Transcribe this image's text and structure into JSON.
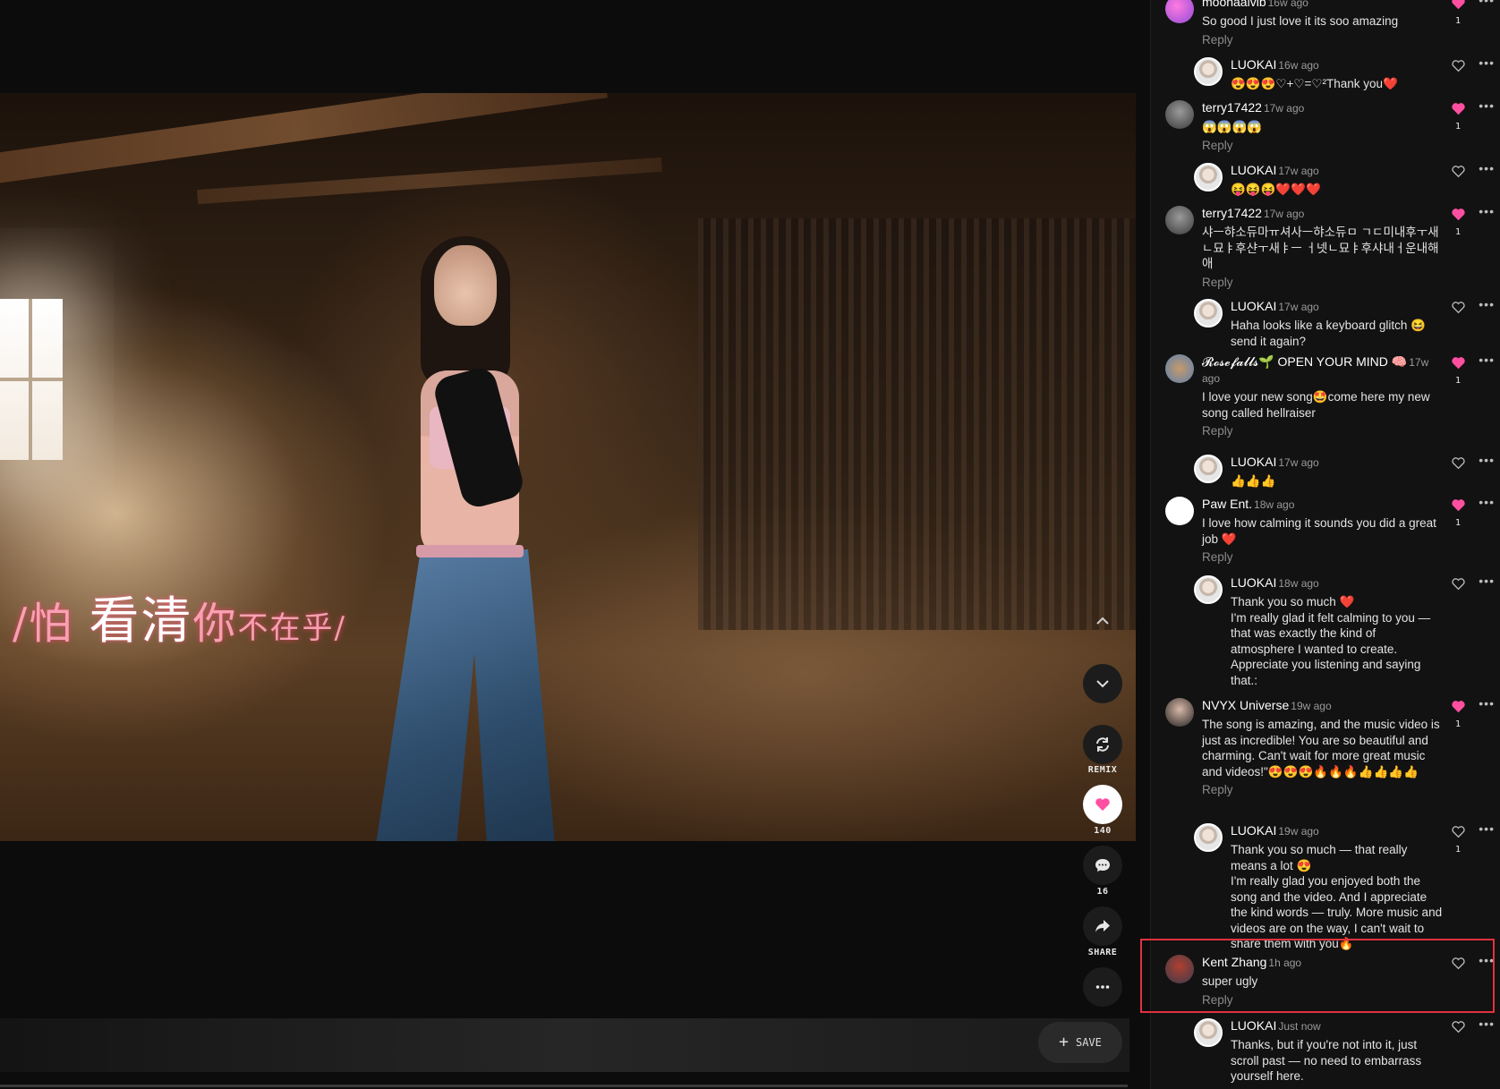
{
  "video": {
    "lyric_prefix": "/怕",
    "lyric_main": "看清",
    "lyric_mid": "你",
    "lyric_tail": "不在乎/"
  },
  "controls": {
    "remix_label": "REMIX",
    "like_count": "140",
    "comment_count": "16",
    "share_label": "SHARE",
    "save_label": "SAVE"
  },
  "colors": {
    "accent_pink": "#ff4fa0",
    "highlight_red": "#e0323f"
  },
  "comments": [
    {
      "name": "moonaalvib",
      "time": "16w ago",
      "text": "So good I just love it its soo amazing",
      "reply": "Reply",
      "likes": "1",
      "liked": true,
      "is_reply": false
    },
    {
      "name": "LUOKAI",
      "time": "16w ago",
      "text": "😍😍😍♡+♡=♡²Thank you❤️",
      "reply": "",
      "likes": "",
      "liked": false,
      "is_reply": true
    },
    {
      "name": "terry17422",
      "time": "17w ago",
      "text": "😱😱😱😱",
      "reply": "Reply",
      "likes": "1",
      "liked": true,
      "is_reply": false
    },
    {
      "name": "LUOKAI",
      "time": "17w ago",
      "text": "😝😝😝❤️❤️❤️",
      "reply": "",
      "likes": "",
      "liked": false,
      "is_reply": true
    },
    {
      "name": "terry17422",
      "time": "17w ago",
      "text": "샤ㅡ햐소듀마ㅠ셔사ㅡ햐소듀ㅁ ㄱㄷ미내후ㅜ새ㄴ묘ㅑ후샨ㅜ새ㅑㅡ ㅓ넷ㄴ묘ㅑ후샤내ㅓ운내해애",
      "reply": "Reply",
      "likes": "1",
      "liked": true,
      "is_reply": false
    },
    {
      "name": "LUOKAI",
      "time": "17w ago",
      "text": "Haha looks like a keyboard glitch 😆 send it again?",
      "reply": "",
      "likes": "",
      "liked": false,
      "is_reply": true
    },
    {
      "name": "𝓡𝓸𝓼𝓮𝓯𝓪𝓵𝓵𝓼🌱 OPEN YOUR MIND 🧠",
      "time": "17w ago",
      "text": "I love your new song🤩come here my new song called hellraiser",
      "reply": "Reply",
      "likes": "1",
      "liked": true,
      "is_reply": false
    },
    {
      "name": "LUOKAI",
      "time": "17w ago",
      "text": "👍👍👍",
      "reply": "",
      "likes": "",
      "liked": false,
      "is_reply": true
    },
    {
      "name": "Paw Ent.",
      "time": "18w ago",
      "text": "I love how calming it sounds you did a great job ❤️",
      "reply": "Reply",
      "likes": "1",
      "liked": true,
      "is_reply": false
    },
    {
      "name": "LUOKAI",
      "time": "18w ago",
      "text": "Thank you so much ❤️\nI'm really glad it felt calming to you — that was exactly the kind of atmosphere I wanted to create. Appreciate you listening and saying that.:",
      "reply": "",
      "likes": "",
      "liked": false,
      "is_reply": true
    },
    {
      "name": "NVYX Universe",
      "time": "19w ago",
      "text": "The song is amazing, and the music video is just as incredible! You are so beautiful and charming. Can't wait for more great music and videos!\"😍😍😍🔥🔥🔥👍👍👍👍",
      "reply": "Reply",
      "likes": "1",
      "liked": true,
      "is_reply": false
    },
    {
      "name": "LUOKAI",
      "time": "19w ago",
      "text": "Thank you so much — that really means a lot 😍\nI'm really glad you enjoyed both the song and the video. And I appreciate the kind words — truly. More music and videos are on the way, I can't wait to share them with you🔥",
      "reply": "",
      "likes": "1",
      "liked": false,
      "is_reply": true
    },
    {
      "name": "Kent Zhang",
      "time": "1h ago",
      "text": "super ugly",
      "reply": "Reply",
      "likes": "",
      "liked": false,
      "is_reply": false
    },
    {
      "name": "LUOKAI",
      "time": "Just now",
      "text": "Thanks, but if you're not into it, just scroll past — no need to embarrass yourself here.",
      "reply": "",
      "likes": "",
      "liked": false,
      "is_reply": true
    }
  ]
}
